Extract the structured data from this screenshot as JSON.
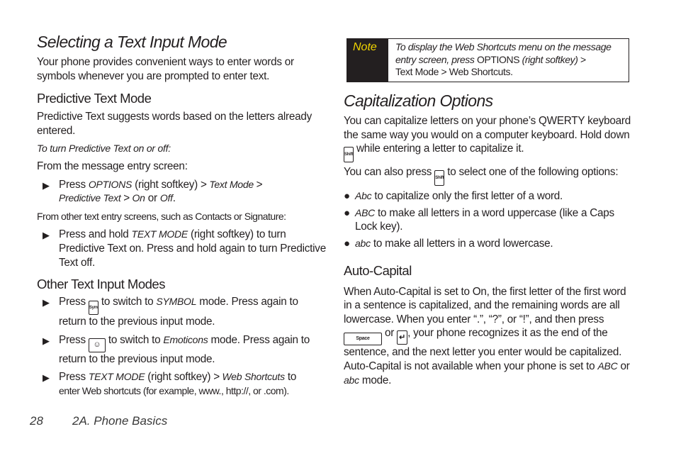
{
  "left": {
    "title": "Selecting a Text Input Mode",
    "intro": "Your phone provides convenient ways to enter words or symbols whenever you are prompted to enter text.",
    "predictive": {
      "heading": "Predictive Text Mode",
      "desc": "Predictive Text suggests words based on the letters already entered.",
      "howto": "To turn Predictive Text on or off:",
      "from_msg": "From the message entry screen:",
      "step1": {
        "press": "Press ",
        "options": "OPTIONS",
        "softkey": " (right softkey) ",
        "gt": ">",
        "text_mode": " Text Mode ",
        "predictive_text": "Predictive Text ",
        "on": " On",
        "or": " or ",
        "off": "Off",
        "period": "."
      },
      "from_other": "From other text entry screens, such as Contacts or Signature:",
      "step2": {
        "press_hold": "Press and hold ",
        "text_mode": "TEXT MODE",
        "rest": " (right softkey) to turn Predictive Text on. Press and hold again to turn Predictive Text off."
      }
    },
    "other": {
      "heading": "Other Text Input Modes",
      "item1": {
        "press": "Press ",
        "key": "Sym",
        "to": " to switch to ",
        "mode": "SYMBOL",
        "rest": " mode. Press again to return to the previous input mode."
      },
      "item2": {
        "press": "Press ",
        "key": "☺",
        "to": " to switch to ",
        "mode": "Emoticons",
        "rest": " mode. Press again to return to the previous input mode."
      },
      "item3": {
        "press": "Press ",
        "text_mode": "TEXT MODE",
        "softkey": " (right softkey) ",
        "gt": ">",
        "web": " Web Shortcuts",
        "to": " to",
        "rest": "enter Web shortcuts (for example, www., http://, or .com)."
      }
    }
  },
  "note": {
    "label": "Note",
    "t1": "To display the Web Shortcuts menu on the message entry screen, press ",
    "options": "OPTIONS",
    "t2": " (right softkey) ",
    "gt": ">",
    "t3": "Text Mode ",
    "t4": " Web Shortcuts",
    "t5": "."
  },
  "right": {
    "title": "Capitalization Options",
    "p1a": "You can capitalize letters on your phone’s QWERTY keyboard the same way you would on a computer keyboard. Hold down ",
    "shift_key": "Shift",
    "p1b": " while entering a letter to capitalize it.",
    "p2a": "You can also press ",
    "p2b": " to select one of the following options:",
    "options": [
      {
        "mode": "Abc",
        "text": " to capitalize only the first letter of a word."
      },
      {
        "mode": "ABC",
        "text": " to make all letters in a word uppercase (like a Caps Lock key)."
      },
      {
        "mode": "abc",
        "text": " to make all letters in a word lowercase."
      }
    ],
    "auto": {
      "heading": "Auto-Capital",
      "t1": "When Auto-Capital is set to On, the first letter of the first word in a sentence is capitalized, and the remaining words are all lowercase. When you enter “.”, “?”, or “!”, and then press ",
      "space_key": "Space",
      "or": " or ",
      "enter_key": "↵",
      "t2": ", your phone recognizes it as the end of the sentence, and the next letter you enter would be capitalized. Auto-Capital is not available when your phone is set to ",
      "abc_upper": "ABC",
      "or2": " or ",
      "abc_lower": "abc",
      "t3": " mode."
    }
  },
  "footer": {
    "page": "28",
    "section": "2A. Phone Basics"
  }
}
